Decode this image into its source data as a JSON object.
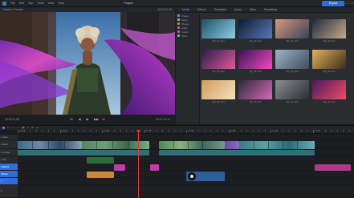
{
  "titlebar": {
    "menu": [
      "File",
      "Edit",
      "Clip",
      "Tools",
      "View",
      "Help"
    ],
    "project_title": "Project",
    "export_label": "Export",
    "window_controls": [
      "–",
      "□",
      "×"
    ]
  },
  "player": {
    "source_label": "Timeline Preview",
    "timecode_top": "00:00:11:08",
    "timecode_left": "00:00:11:08",
    "timecode_right": "00:01:24:12",
    "controls": [
      "⏮",
      "◀",
      "▶",
      "▶▶",
      "⏭"
    ]
  },
  "media": {
    "tabs": [
      "Media",
      "Effects",
      "Templates",
      "Audio",
      "Titles",
      "Transitions"
    ],
    "active_tab": 0,
    "folders": [
      {
        "label": "Project",
        "color": "#4f9dff"
      },
      {
        "label": "Video",
        "color": "#e0a33a"
      },
      {
        "label": "Photos",
        "color": "#59b36b"
      },
      {
        "label": "Audio",
        "color": "#c75bd0"
      },
      {
        "label": "Colors",
        "color": "#e25b5b"
      },
      {
        "label": "Titles",
        "color": "#57c2c2"
      }
    ],
    "thumbs": [
      {
        "label": "clip_01.mp4",
        "c1": "#1f4f66",
        "c2": "#8bd0e6"
      },
      {
        "label": "clip_02.mp4",
        "c1": "#0d1b33",
        "c2": "#5b79b8"
      },
      {
        "label": "clip_03.mp4",
        "c1": "#d89a7a",
        "c2": "#36425c"
      },
      {
        "label": "clip_04.mp4",
        "c1": "#1c2b3d",
        "c2": "#c9a98a"
      },
      {
        "label": "clip_05.mp4",
        "c1": "#2a1a4a",
        "c2": "#e05a9b"
      },
      {
        "label": "clip_06.mp4",
        "c1": "#3a1256",
        "c2": "#f04cc0"
      },
      {
        "label": "clip_07.mp4",
        "c1": "#9fb4c8",
        "c2": "#3c4c5e"
      },
      {
        "label": "clip_08.mp4",
        "c1": "#e6b45a",
        "c2": "#3a2a1a"
      },
      {
        "label": "clip_09.mp4",
        "c1": "#d49a5a",
        "c2": "#f3e2c2"
      },
      {
        "label": "clip_10.mp4",
        "c1": "#2a2a3a",
        "c2": "#d46ab8"
      },
      {
        "label": "clip_11.mp4",
        "c1": "#8a8f96",
        "c2": "#2a2c30"
      },
      {
        "label": "clip_12.mp4",
        "c1": "#4a1a5a",
        "c2": "#f24a6a"
      }
    ]
  },
  "timeline": {
    "ruler_labels": [
      "00:00",
      "00:10",
      "00:20",
      "00:30",
      "00:40",
      "00:50",
      "01:00",
      "01:10"
    ],
    "tools": [
      "↖",
      "✂",
      "⇔",
      "⌖",
      "🔊",
      "T",
      "⊞",
      "⊟"
    ],
    "tracks": [
      {
        "label": "1 Video"
      },
      {
        "label": "2 Audio"
      },
      {
        "label": "3 Overlay"
      },
      {
        "label": "4 Title"
      },
      {
        "label": "5 Effects"
      },
      {
        "label": "6 Music"
      },
      {
        "label": "7"
      },
      {
        "label": "8"
      }
    ]
  }
}
